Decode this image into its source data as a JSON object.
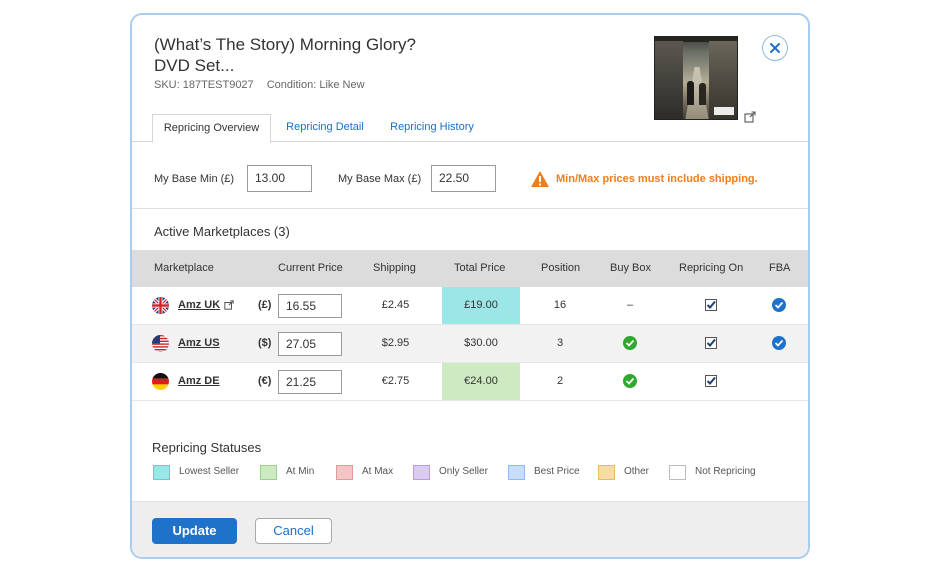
{
  "product": {
    "title_line1": "(What’s The Story) Morning Glory?",
    "title_line2": "DVD Set...",
    "sku": "SKU: 187TEST9027",
    "condition": "Condition: Like New"
  },
  "tabs": [
    {
      "label": "Repricing Overview",
      "active": true
    },
    {
      "label": "Repricing Detail",
      "active": false
    },
    {
      "label": "Repricing History",
      "active": false
    }
  ],
  "base": {
    "min_label": "My Base Min (£)",
    "min_value": "13.00",
    "max_label": "My Base Max (£)",
    "max_value": "22.50",
    "warning": "Min/Max prices must include shipping."
  },
  "marketplaces": {
    "title": "Active Marketplaces (3)",
    "columns": [
      "Marketplace",
      "Current Price",
      "Shipping",
      "Total Price",
      "Position",
      "Buy Box",
      "Repricing On",
      "FBA"
    ],
    "rows": [
      {
        "name": "Amz UK",
        "flag": "uk",
        "currency": "(£)",
        "price": "16.55",
        "shipping": "£2.45",
        "total": "£19.00",
        "total_status": "lowest-seller",
        "position": "16",
        "buy_box": "–",
        "repricing_on": true,
        "fba": true
      },
      {
        "name": "Amz US",
        "flag": "us",
        "currency": "($)",
        "price": "27.05",
        "shipping": "$2.95",
        "total": "$30.00",
        "total_status": "none",
        "position": "3",
        "buy_box": "check",
        "repricing_on": true,
        "fba": true
      },
      {
        "name": "Amz DE",
        "flag": "de",
        "currency": "(€)",
        "price": "21.25",
        "shipping": "€2.75",
        "total": "€24.00",
        "total_status": "at-min",
        "position": "2",
        "buy_box": "check",
        "repricing_on": true,
        "fba": false
      }
    ]
  },
  "statuses": {
    "title": "Repricing Statuses",
    "items": [
      {
        "label": "Lowest Seller",
        "color": "#9be6e6",
        "border": "#5fcfcf"
      },
      {
        "label": "At Min",
        "color": "#cdeac2",
        "border": "#9fd08c"
      },
      {
        "label": "At Max",
        "color": "#f2c6c6",
        "border": "#e29a9a"
      },
      {
        "label": "Only Seller",
        "color": "#dccbf0",
        "border": "#b89ee0"
      },
      {
        "label": "Best Price",
        "color": "#c6def7",
        "border": "#8fbcee"
      },
      {
        "label": "Other",
        "color": "#f8dca6",
        "border": "#eabb64"
      },
      {
        "label": "Not Repricing",
        "color": "#ffffff",
        "border": "#bdbdbd"
      }
    ]
  },
  "footer": {
    "update_label": "Update",
    "cancel_label": "Cancel"
  },
  "colors": {
    "accent": "#1f72c9",
    "warning": "#ef7d1a",
    "check_green": "#2ea82e",
    "check_blue": "#1f72c9"
  }
}
